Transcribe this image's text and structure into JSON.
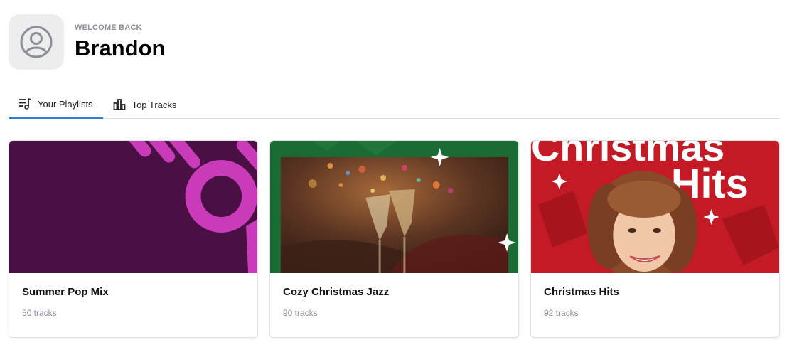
{
  "header": {
    "eyebrow": "WELCOME BACK",
    "username": "Brandon",
    "avatar_icon": "user-circle-icon"
  },
  "tabs": [
    {
      "label": "Your Playlists",
      "icon": "playlist-icon",
      "active": true
    },
    {
      "label": "Top Tracks",
      "icon": "bar-chart-icon",
      "active": false
    }
  ],
  "playlists": [
    {
      "title": "Summer Pop Mix",
      "tracks": "50 tracks",
      "cover_bg": "#4a1043",
      "accent": "#c93bb8"
    },
    {
      "title": "Cozy Christmas Jazz",
      "tracks": "90 tracks",
      "cover_bg": "#1b6b34",
      "accent": "#ffffff"
    },
    {
      "title": "Christmas Hits",
      "tracks": "92 tracks",
      "cover_bg": "#c41a26",
      "accent": "#ffffff",
      "cover_text": [
        "Christmas",
        "Hits"
      ]
    }
  ],
  "colors": {
    "tab_active": "#2d7fd6",
    "muted_text": "#8a8f98"
  }
}
